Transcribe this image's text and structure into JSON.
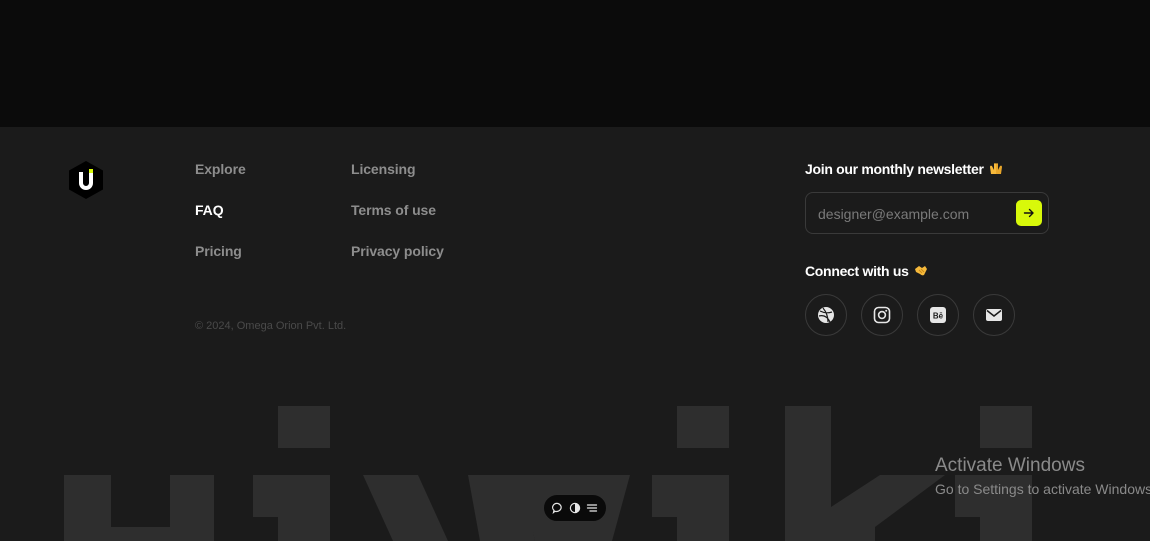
{
  "brand": {
    "logo_letter": "u"
  },
  "nav": {
    "col1": [
      {
        "label": "Explore",
        "active": false
      },
      {
        "label": "FAQ",
        "active": true
      },
      {
        "label": "Pricing",
        "active": false
      }
    ],
    "col2": [
      {
        "label": "Licensing"
      },
      {
        "label": "Terms of use"
      },
      {
        "label": "Privacy policy"
      }
    ]
  },
  "copyright": "© 2024, Omega Orion Pvt. Ltd.",
  "newsletter": {
    "title": "Join our monthly newsletter",
    "title_emoji": "raising-hands-icon",
    "placeholder": "designer@example.com",
    "value": "",
    "submit_icon": "arrow-right-icon"
  },
  "connect": {
    "title": "Connect with us",
    "title_emoji": "handshake-icon",
    "socials": [
      "dribbble-icon",
      "instagram-icon",
      "behance-icon",
      "mail-icon"
    ]
  },
  "watermark": {
    "text": "uiwiki"
  },
  "os_notice": {
    "title": "Activate Windows",
    "subtitle": "Go to Settings to activate Windows."
  },
  "toolbar": {
    "icons": [
      "comment-icon",
      "theme-toggle-icon",
      "menu-lines-icon"
    ]
  },
  "colors": {
    "accent": "#d8f90a",
    "background": "#1b1b1b",
    "top_band": "#0b0b0b",
    "muted_text": "#8d8d8d"
  }
}
